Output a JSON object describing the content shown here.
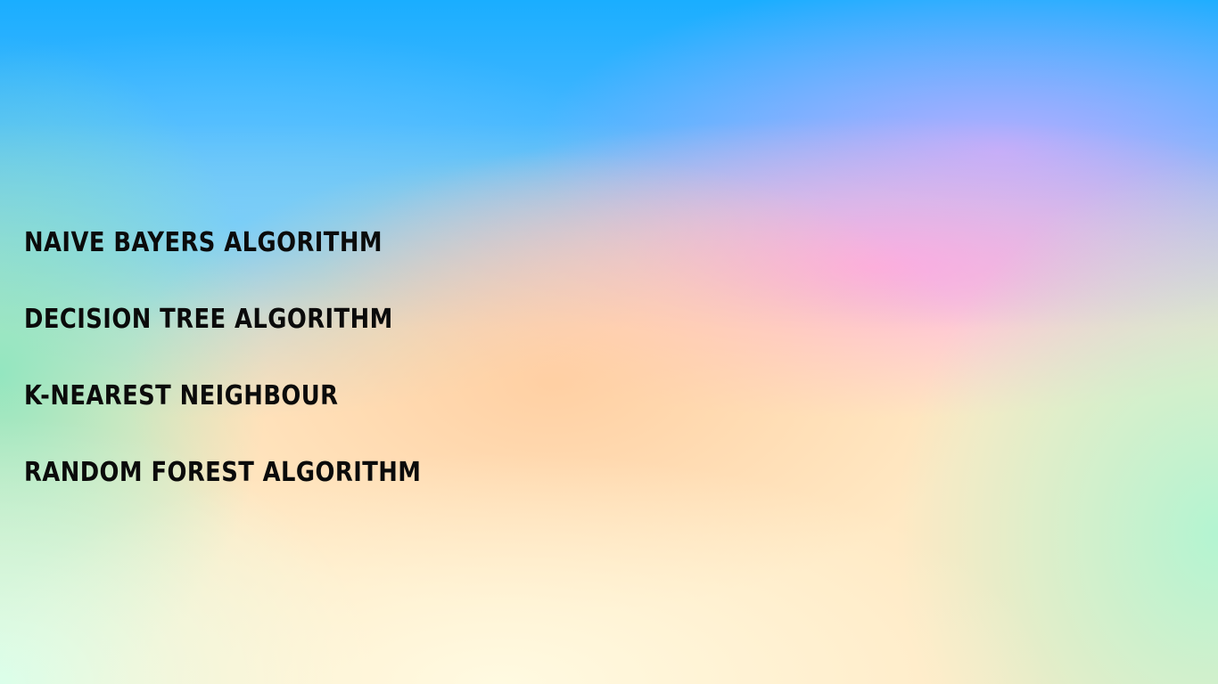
{
  "slide": {
    "items": [
      {
        "label": "NAIVE BAYERS ALGORITHM"
      },
      {
        "label": "DECISION TREE ALGORITHM"
      },
      {
        "label": "K-NEAREST NEIGHBOUR"
      },
      {
        "label": "RANDOM FOREST ALGORITHM"
      }
    ],
    "colors": {
      "text": "#0b0b0b",
      "sky": "#1aaeff",
      "pink": "#ffaae1",
      "peach": "#ffcda0",
      "mint": "#afF5d2"
    }
  }
}
